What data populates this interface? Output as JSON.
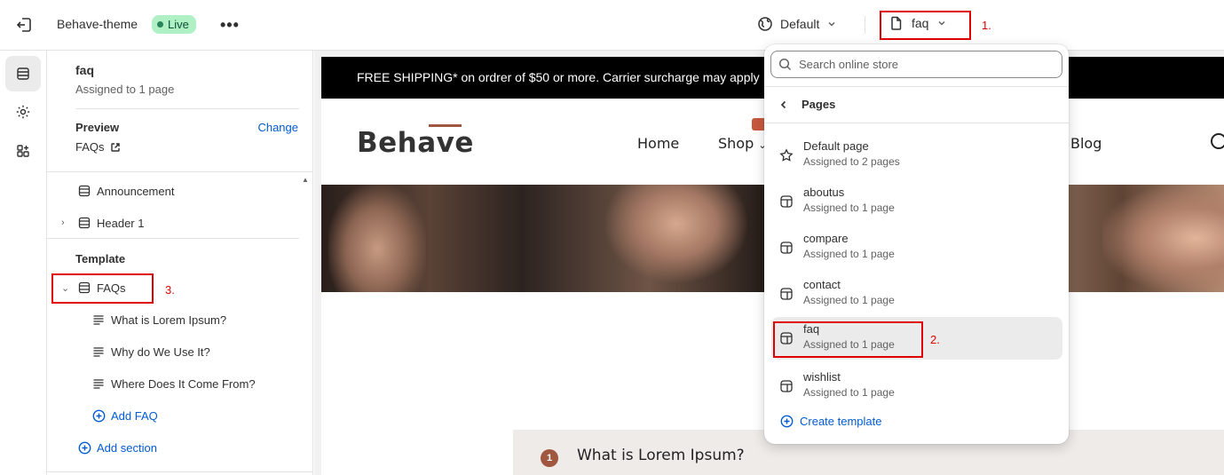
{
  "topbar": {
    "theme_name": "Behave-theme",
    "status": "Live",
    "more": "•••",
    "context": "Default",
    "template": "faq"
  },
  "annotations": {
    "one": "1.",
    "two": "2.",
    "three": "3."
  },
  "sidebar": {
    "selected_title": "faq",
    "selected_subtitle": "Assigned to 1 page",
    "preview_label": "Preview",
    "change_label": "Change",
    "preview_page": "FAQs",
    "sections": [
      {
        "label": "Announcement"
      },
      {
        "label": "Header 1"
      }
    ],
    "template_label": "Template",
    "template_section": "FAQs",
    "blocks": [
      {
        "label": "What is Lorem Ipsum?"
      },
      {
        "label": "Why do We Use It?"
      },
      {
        "label": "Where Does It Come From?"
      }
    ],
    "add_faq": "Add FAQ",
    "add_section": "Add section"
  },
  "preview": {
    "announcement": "FREE SHIPPING* on ordrer of $50 or more. Carrier surcharge may apply",
    "logo": "Behave",
    "nav": {
      "home": "Home",
      "shop": "Shop",
      "blog": "Blog"
    },
    "faq_number": "1",
    "faq_question": "What is Lorem Ipsum?"
  },
  "dropdown": {
    "search_placeholder": "Search online store",
    "back_label": "Pages",
    "items": [
      {
        "title": "Default page",
        "subtitle": "Assigned to 2 pages",
        "icon": "star-icon"
      },
      {
        "title": "aboutus",
        "subtitle": "Assigned to 1 page",
        "icon": "page-template-icon"
      },
      {
        "title": "compare",
        "subtitle": "Assigned to 1 page",
        "icon": "page-template-icon"
      },
      {
        "title": "contact",
        "subtitle": "Assigned to 1 page",
        "icon": "page-template-icon"
      },
      {
        "title": "faq",
        "subtitle": "Assigned to 1 page",
        "icon": "page-template-icon",
        "selected": true
      },
      {
        "title": "wishlist",
        "subtitle": "Assigned to 1 page",
        "icon": "page-template-icon"
      }
    ],
    "create_label": "Create template"
  },
  "colors": {
    "accent": "#005bd3",
    "annotation": "#e00000",
    "live_bg": "#aff0c5",
    "brand": "#a0573f"
  }
}
